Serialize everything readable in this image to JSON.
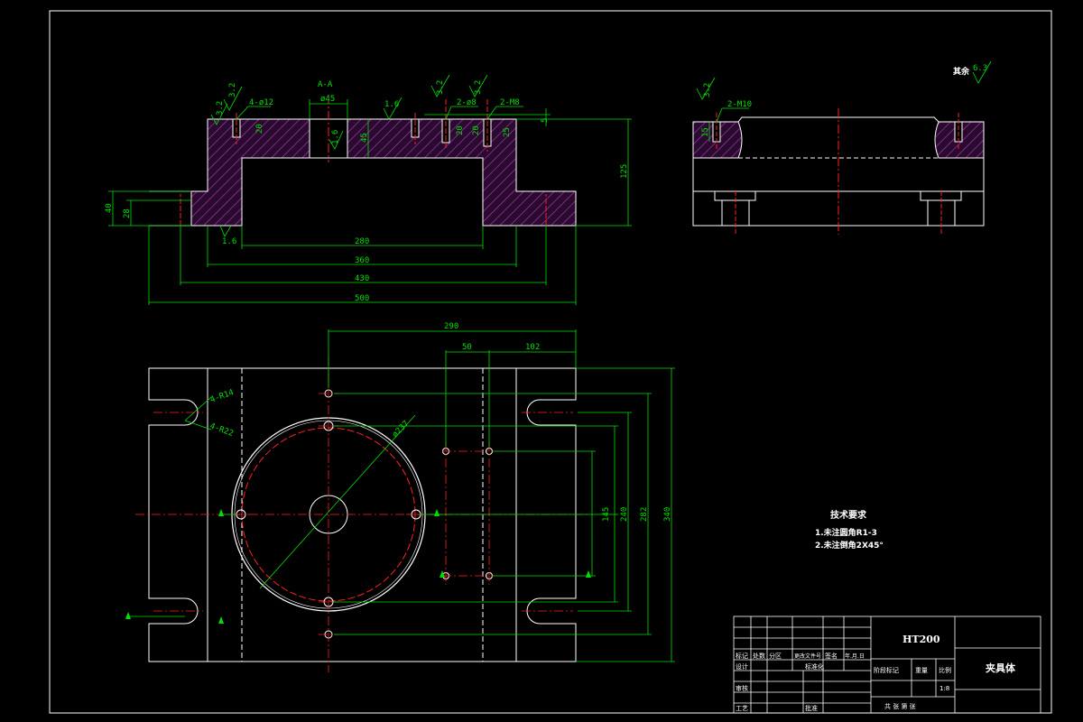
{
  "colors": {
    "background": "#000000",
    "outline": "#ffffff",
    "dimension": "#00e000",
    "centerline": "#ff2020",
    "hatch": "#b040c0",
    "hatch_fill": "#2a0a2e"
  },
  "front_view": {
    "top_labels": {
      "section": "A-A",
      "holes_12": "4-ø12",
      "bore_45": "ø45",
      "holes_8": "2-ø8",
      "thread_m8": "2-M8"
    },
    "roughness": [
      "3.2",
      "3.2",
      "1.6",
      "3.2",
      "3.2",
      "1.6",
      "1.6"
    ],
    "dims": {
      "d280": "280",
      "d360": "360",
      "d430": "430",
      "d500": "500",
      "d125": "125",
      "d40": "40",
      "d28": "28",
      "d45": "45",
      "d20a": "20",
      "d20b": "20",
      "d20c": "20",
      "d25": "25",
      "d5": "5"
    }
  },
  "side_view": {
    "roughness_all": "其余",
    "roughness_value": "6.3",
    "roughness_local": "3.2",
    "thread": "2-M10",
    "depth": "15"
  },
  "top_view": {
    "dims": {
      "d290": "290",
      "d50": "50",
      "d102": "102",
      "d145": "145",
      "d240": "240",
      "d282": "282",
      "d340": "340"
    },
    "labels": {
      "slot14": "4-R14",
      "slot22": "4-R22",
      "circle": "ø237",
      "mark": "A"
    }
  },
  "tech_requirements": {
    "title": "技术要求",
    "items": [
      "1.未注圆角R1-3",
      "2.未注倒角2X45°"
    ]
  },
  "title_block": {
    "material": "HT200",
    "part_name": "夹具体",
    "scale": "1:8",
    "row_labels": [
      "标记",
      "设计",
      "审核",
      "工艺"
    ],
    "col_labels": [
      "处数",
      "分区",
      "更改文件号",
      "签名",
      "年.月.日"
    ],
    "stage_label": "阶段标记",
    "weight_label": "重量",
    "scale_label": "比例",
    "std_label": "标准化",
    "approve_label": "批准",
    "sheet_label": "共 张 第 张"
  }
}
